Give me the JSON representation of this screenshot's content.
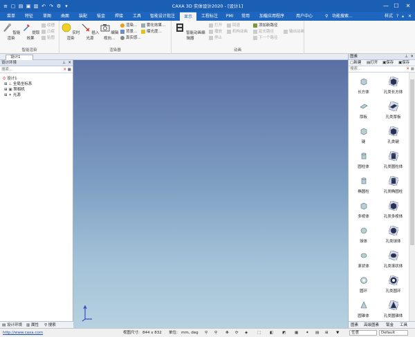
{
  "window": {
    "title": "CAXA 3D 实体设计2020 - [设计1]",
    "minimize": "—",
    "maximize": "☐",
    "close": "✕"
  },
  "tabs": [
    {
      "label": "菜单"
    },
    {
      "label": "特征"
    },
    {
      "label": "草图"
    },
    {
      "label": "曲面"
    },
    {
      "label": "装配"
    },
    {
      "label": "钣金"
    },
    {
      "label": "焊接"
    },
    {
      "label": "工具"
    },
    {
      "label": "智能设计批注"
    },
    {
      "label": "显示",
      "active": true
    },
    {
      "label": "工程标注"
    },
    {
      "label": "PMI"
    },
    {
      "label": "常用"
    },
    {
      "label": "加载应用程序"
    },
    {
      "label": "用户中心"
    }
  ],
  "ribbon_right": {
    "search": "功能搜索...",
    "style": "样式",
    "help": "?"
  },
  "ribbon": {
    "groups": [
      {
        "label": "智能渲染",
        "big": [
          {
            "label": "智能渲染"
          },
          {
            "label": "提取效果"
          }
        ],
        "small": [
          {
            "label": "纹理",
            "disabled": true
          },
          {
            "label": "凸痕",
            "disabled": true
          },
          {
            "label": "贴图",
            "disabled": true
          }
        ]
      },
      {
        "label": "渲染器",
        "big": [
          {
            "label": "实时渲染"
          },
          {
            "label": "插入光源"
          },
          {
            "label": "编辑视向..."
          }
        ],
        "small": [
          {
            "label": "渲染..."
          },
          {
            "label": "背景..."
          },
          {
            "label": "真实感..."
          },
          {
            "label": "雾化效果..."
          },
          {
            "label": "曝光度..."
          }
        ]
      },
      {
        "label": "动画",
        "big": [
          {
            "label": "智能动画编辑器"
          }
        ],
        "small": [
          {
            "label": "打开",
            "disabled": true
          },
          {
            "label": "播放",
            "disabled": true
          },
          {
            "label": "停止",
            "disabled": true
          },
          {
            "label": "回退",
            "disabled": true
          },
          {
            "label": "机构动画",
            "disabled": true
          },
          {
            "label": "添加新路径"
          },
          {
            "label": "延长路径",
            "disabled": true
          },
          {
            "label": "下一个路径",
            "disabled": true
          },
          {
            "label": "输出动画",
            "disabled": true
          }
        ]
      }
    ]
  },
  "doc_tab": {
    "label": "设计1"
  },
  "left_panel": {
    "title": "设计环境",
    "search_placeholder": "搜索...",
    "tree": [
      {
        "label": "设计1"
      },
      {
        "label": "全局坐标系"
      },
      {
        "label": "照相机"
      },
      {
        "label": "光源"
      }
    ],
    "tabs": [
      {
        "label": "设计环境"
      },
      {
        "label": "属性"
      },
      {
        "label": "搜索"
      }
    ]
  },
  "right_panel": {
    "title": "图素",
    "buttons": [
      {
        "label": "新建"
      },
      {
        "label": "打开"
      },
      {
        "label": "保存"
      },
      {
        "label": "保存"
      }
    ],
    "search_placeholder": "搜索...",
    "items": [
      {
        "label": "长方体",
        "icon": "cube"
      },
      {
        "label": "孔类长方体",
        "icon": "hole-cube"
      },
      {
        "label": "厚板",
        "icon": "plate"
      },
      {
        "label": "孔类厚板",
        "icon": "hole-plate"
      },
      {
        "label": "键",
        "icon": "key"
      },
      {
        "label": "孔类键",
        "icon": "hole-key"
      },
      {
        "label": "圆柱体",
        "icon": "cylinder"
      },
      {
        "label": "孔类圆柱体",
        "icon": "hole-cylinder"
      },
      {
        "label": "椭圆柱",
        "icon": "ellipse-cylinder"
      },
      {
        "label": "孔类椭圆柱",
        "icon": "hole-ellipse"
      },
      {
        "label": "多棱体",
        "icon": "prism"
      },
      {
        "label": "孔类多棱体",
        "icon": "hole-prism"
      },
      {
        "label": "球体",
        "icon": "sphere"
      },
      {
        "label": "孔类球体",
        "icon": "hole-sphere"
      },
      {
        "label": "滚状体",
        "icon": "roller"
      },
      {
        "label": "孔类滚状体",
        "icon": "hole-roller"
      },
      {
        "label": "圆环",
        "icon": "torus"
      },
      {
        "label": "孔类圆环",
        "icon": "hole-torus"
      },
      {
        "label": "圆锥体",
        "icon": "cone"
      },
      {
        "label": "孔类圆锥体",
        "icon": "hole-cone"
      }
    ],
    "tabs": [
      {
        "label": "图素"
      },
      {
        "label": "高级图素"
      },
      {
        "label": "钣金"
      },
      {
        "label": "工具"
      }
    ]
  },
  "status": {
    "link": "http://www.caxa.com",
    "view_size_label": "视图尺寸:",
    "view_size_value": "844 x 832",
    "unit_label": "单位:",
    "unit_value": "mm, deg",
    "mode_value": "任意",
    "style_value": "Default"
  },
  "colors": {
    "titlebar": "#1b5fb5",
    "tabbar": "#1e66bd",
    "viewport_top": "#5a6fa4",
    "viewport_bottom": "#b6d1df"
  }
}
